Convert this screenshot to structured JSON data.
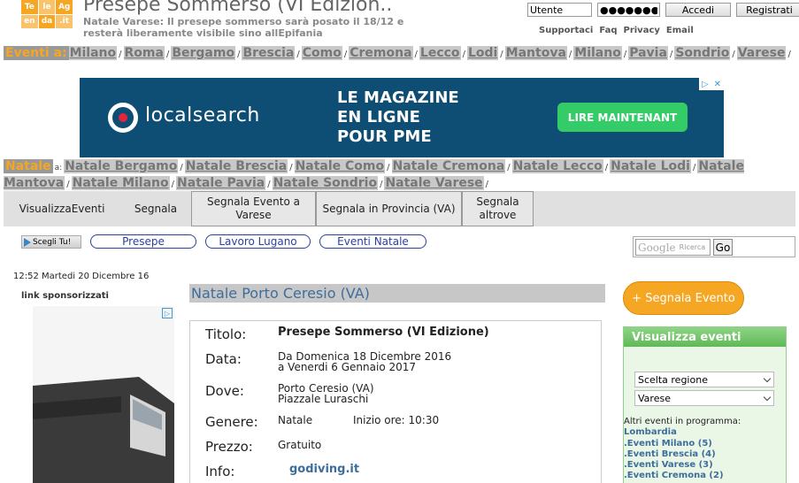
{
  "header": {
    "logo_cells": [
      "Te",
      "le",
      "Ag",
      "en",
      "da",
      ".it"
    ],
    "title": "Presepe Sommerso (VI Edizion..",
    "subtitle": "Natale Varese: Il presepe sommerso sarà posato il 18/12 e resterà liberamente visibile sino allEpifania"
  },
  "login": {
    "user_value": "Utente",
    "password_value": "●●●●●●●●",
    "login_label": "Accedi",
    "register_label": "Registrati"
  },
  "toplinks": [
    "Supportaci",
    "Faq",
    "Privacy",
    "Email"
  ],
  "nav1": {
    "prefix": "Eventi a:",
    "items": [
      "Milano",
      "Roma",
      "Bergamo",
      "Brescia",
      "Como",
      "Cremona",
      "Lecco",
      "Lodi",
      "Mantova",
      "Milano",
      "Pavia",
      "Sondrio",
      "Varese"
    ]
  },
  "banner": {
    "brand": "localsearch",
    "headline": [
      "LE MAGAZINE",
      "EN LIGNE",
      "POUR PME"
    ],
    "cta": "LIRE MAINTENANT"
  },
  "nav2": {
    "prefix": "Natale",
    "prefix_suffix": "a:",
    "items": [
      "Natale Bergamo",
      "Natale Brescia",
      "Natale Como",
      "Natale Cremona",
      "Natale Lecco",
      "Natale Lodi",
      "Natale Mantova",
      "Natale Milano",
      "Natale Pavia",
      "Natale Sondrio",
      "Natale Varese"
    ]
  },
  "tabs": [
    {
      "label": "VisualizzaEventi"
    },
    {
      "label": "Segnala"
    },
    {
      "label": "Segnala Evento a Varese"
    },
    {
      "label": "Segnala in Provincia (VA)"
    },
    {
      "label": "Segnala altrove"
    }
  ],
  "pills": {
    "scegli": "Scegli Tu!",
    "items": [
      "Presepe",
      "Lavoro Lugano",
      "Eventi Natale"
    ]
  },
  "search": {
    "brand": "Google",
    "placeholder": "Ricerca",
    "button": "Go"
  },
  "left": {
    "dateline": "12:52 Martedi 20 Dicembre 16",
    "sponsor": "link sponsorizzati"
  },
  "event": {
    "heading": "Natale Porto Ceresio (VA)",
    "titolo_label": "Titolo:",
    "titolo": "Presepe Sommerso (VI Edizione)",
    "data_label": "Data:",
    "data_from": "Da Domenica 18 Dicembre 2016",
    "data_to": "a Venerdi 6 Gennaio 2017",
    "dove_label": "Dove:",
    "dove_city": "Porto Ceresio (VA)",
    "dove_place": "Piazzale Luraschi",
    "genere_label": "Genere:",
    "genere": "Natale",
    "inizio": "Inizio ore: 10:30",
    "prezzo_label": "Prezzo:",
    "prezzo": "Gratuito",
    "info_label": "Info:",
    "info": "godiving.it"
  },
  "right": {
    "segnala_btn": "+ Segnala Evento",
    "panel_title": "Visualizza eventi",
    "select_region": "Scelta regione",
    "select_city": "Varese",
    "others": "Altri eventi in programma:",
    "region": "Lombardia",
    "links": [
      ".Eventi Milano (5)",
      ".Eventi Brescia (4)",
      ".Eventi Varese (3)",
      ".Eventi Cremona (2)"
    ]
  },
  "colors": {
    "accent_orange": "#f5a623",
    "link_blue": "#3d6e9b",
    "banner_bg": "#0e4e74",
    "banner_cta": "#33cc66",
    "panel_green": "#5fb956"
  }
}
